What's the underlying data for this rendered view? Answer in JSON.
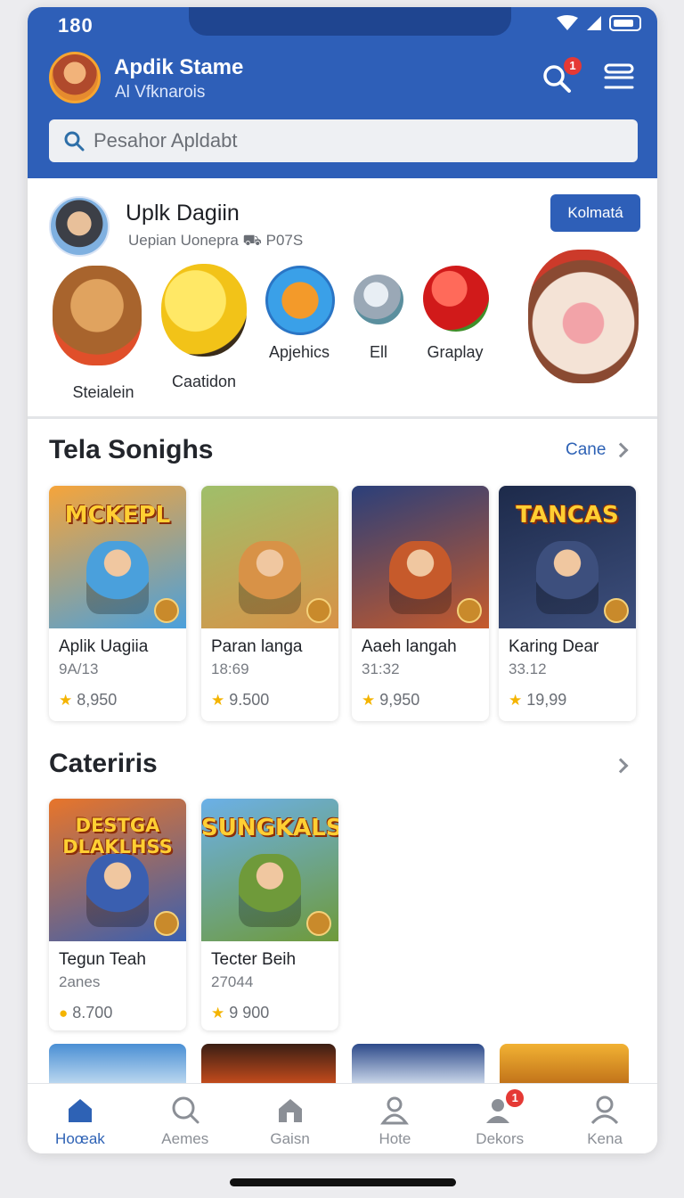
{
  "status_bar": {
    "time": "180"
  },
  "header": {
    "title": "Apdik Stame",
    "subtitle": "Al Vfknarois",
    "search_badge": "1",
    "search_placeholder": "Pesahor Apldabt"
  },
  "profile": {
    "name": "Uplk Dagiin",
    "meta": "Uepian Uonepra  ⛟ P07S",
    "follow_label": "Kolmatá"
  },
  "characters": [
    {
      "label": "Steialein",
      "icon": "bear-character-icon"
    },
    {
      "label": "Caatidon",
      "icon": "yellow-blob-character-icon"
    },
    {
      "label": "Apjehics",
      "icon": "vepper-badge-icon"
    },
    {
      "label": "Ell",
      "icon": "silver-coin-icon"
    },
    {
      "label": "Graplay",
      "icon": "red-ball-icon"
    }
  ],
  "section_trending": {
    "title": "Tela Sonighs",
    "see_all": "Cane",
    "games": [
      {
        "thumb_text": "MCKEPL",
        "name": "Aplik Uagiia",
        "sub": "9A/13",
        "rating": "8,950",
        "colors": [
          "#f6a43a",
          "#4aa0dc"
        ]
      },
      {
        "thumb_text": "",
        "name": "Paran langa",
        "sub": "18:69",
        "rating": "9.500",
        "colors": [
          "#9fbf6a",
          "#d89247"
        ]
      },
      {
        "thumb_text": "",
        "name": "Aaeh langah",
        "sub": "31:32",
        "rating": "9,950",
        "colors": [
          "#2a3f7a",
          "#c65a2b"
        ]
      },
      {
        "thumb_text": "TANCAS",
        "name": "Karing Dear",
        "sub": "33.12",
        "rating": "19,99",
        "colors": [
          "#1d2a4a",
          "#3d4f7d"
        ]
      }
    ]
  },
  "section_categories": {
    "title": "Cateriris",
    "games": [
      {
        "thumb_text": "DESTGA DLAKLHSS",
        "name": "Tegun Teah",
        "sub": "2anes",
        "rating": "8.700",
        "rating_icon": "coin",
        "colors": [
          "#e8752a",
          "#3a5fb0"
        ]
      },
      {
        "thumb_text": "SUNGKALS",
        "name": "Tecter Beih",
        "sub": "27044",
        "rating": "9 900",
        "rating_icon": "star",
        "colors": [
          "#6bb0e8",
          "#6f9a3a"
        ]
      }
    ]
  },
  "bottom_nav": [
    {
      "label": "Hoœak",
      "icon": "home-icon",
      "active": true,
      "badge": ""
    },
    {
      "label": "Aemes",
      "icon": "search-icon",
      "active": false,
      "badge": ""
    },
    {
      "label": "Gaisn",
      "icon": "store-icon",
      "active": false,
      "badge": ""
    },
    {
      "label": "Hote",
      "icon": "friends-icon",
      "active": false,
      "badge": ""
    },
    {
      "label": "Dekors",
      "icon": "inbox-icon",
      "active": false,
      "badge": "1"
    },
    {
      "label": "Kena",
      "icon": "profile-icon",
      "active": false,
      "badge": ""
    }
  ],
  "colors": {
    "brand": "#2e5fb8",
    "accent_link": "#2e62b5",
    "badge": "#e53935",
    "star": "#f4b400"
  }
}
